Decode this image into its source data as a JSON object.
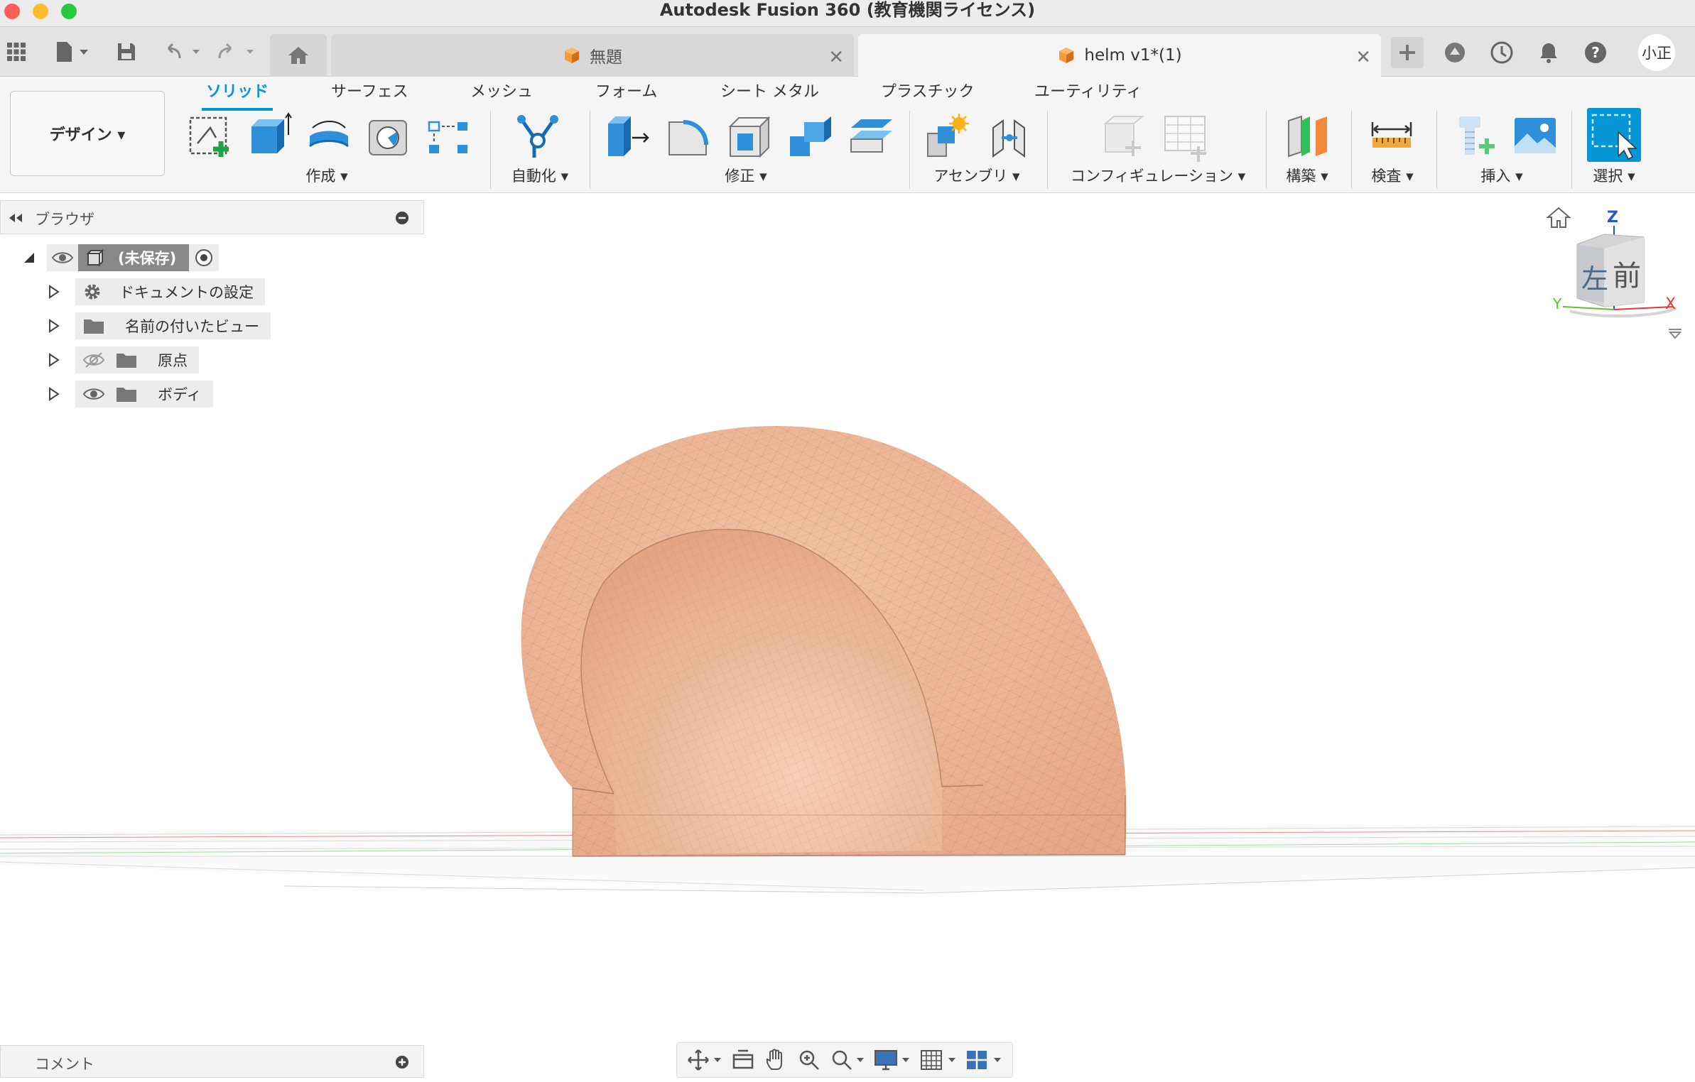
{
  "window": {
    "title": "Autodesk Fusion 360 (教育機関ライセンス)"
  },
  "tabs": [
    {
      "label": "無題",
      "active": false
    },
    {
      "label": "helm v1*(1)",
      "active": true
    }
  ],
  "user": {
    "initials": "小正"
  },
  "workspace": {
    "label": "デザイン ▾"
  },
  "ribbon_tabs": [
    "ソリッド",
    "サーフェス",
    "メッシュ",
    "フォーム",
    "シート メタル",
    "プラスチック",
    "ユーティリティ"
  ],
  "ribbon_groups": {
    "create": "作成 ▾",
    "automate": "自動化 ▾",
    "modify": "修正 ▾",
    "assemble": "アセンブリ ▾",
    "configure": "コンフィギュレーション ▾",
    "construct": "構築 ▾",
    "inspect": "検査 ▾",
    "insert": "挿入 ▾",
    "select": "選択 ▾"
  },
  "browser": {
    "title": "ブラウザ",
    "root": "(未保存)",
    "items": [
      "ドキュメントの設定",
      "名前の付いたビュー",
      "原点",
      "ボディ"
    ]
  },
  "viewcube": {
    "left": "左",
    "front": "前",
    "x": "X",
    "y": "Y",
    "z": "Z"
  },
  "comments": {
    "label": "コメント"
  },
  "colors": {
    "accent": "#0696d7",
    "model": "#eeb596",
    "tab_active": "#f4f4f4"
  }
}
